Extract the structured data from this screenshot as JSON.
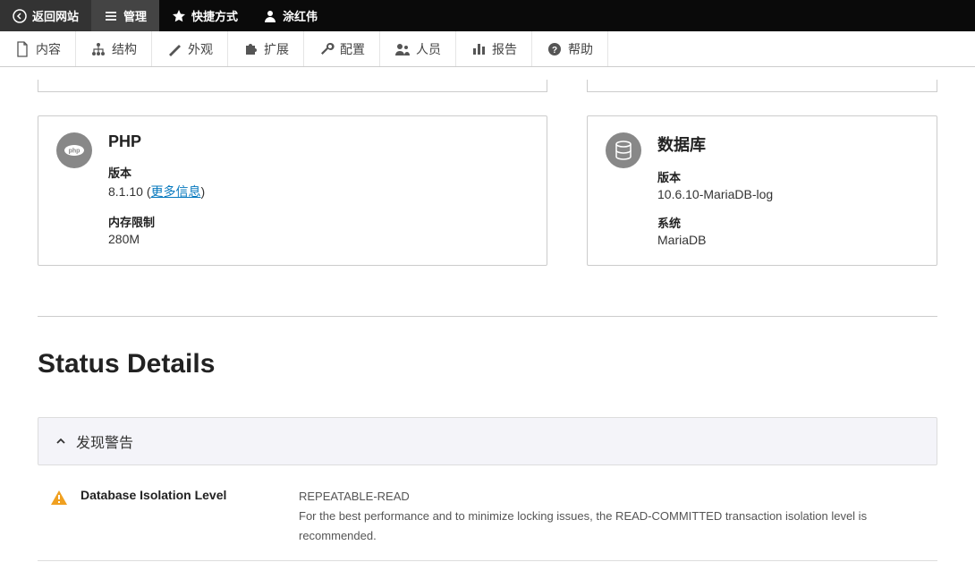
{
  "topbar": {
    "back": "返回网站",
    "manage": "管理",
    "shortcut": "快捷方式",
    "user": "涂红伟"
  },
  "secondbar": {
    "content": "内容",
    "structure": "结构",
    "appearance": "外观",
    "extend": "扩展",
    "config": "配置",
    "people": "人员",
    "reports": "报告",
    "help": "帮助"
  },
  "cards": {
    "php": {
      "title": "PHP",
      "version_label": "版本",
      "version_value": "8.1.10",
      "more_info": "更多信息",
      "memory_label": "内存限制",
      "memory_value": "280M"
    },
    "db": {
      "title": "数据库",
      "version_label": "版本",
      "version_value": "10.6.10-MariaDB-log",
      "system_label": "系统",
      "system_value": "MariaDB"
    }
  },
  "status": {
    "title": "Status Details",
    "accordion_title": "发现警告",
    "rows": {
      "isolation": {
        "name": "Database Isolation Level",
        "value": "REPEATABLE-READ",
        "desc": "For the best performance and to minimize locking issues, the READ-COMMITTED transaction isolation level is recommended."
      }
    }
  }
}
